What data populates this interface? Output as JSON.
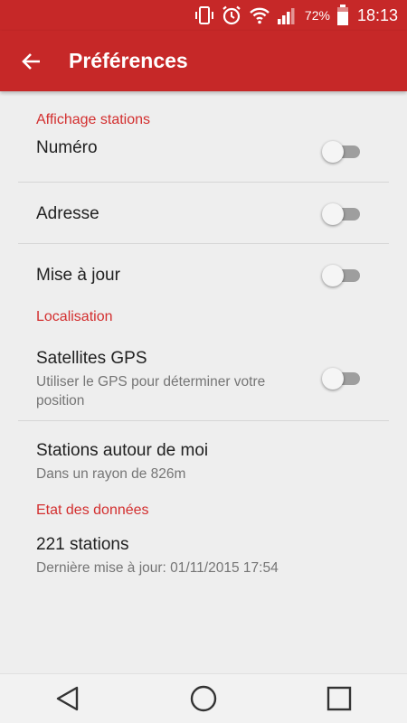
{
  "status_bar": {
    "battery_percent": "72%",
    "time": "18:13",
    "icons": [
      "vibrate-icon",
      "alarm-icon",
      "wifi-icon",
      "signal-icon",
      "battery-icon"
    ]
  },
  "app_bar": {
    "title": "Préférences",
    "back_icon": "arrow-back-icon"
  },
  "sections": {
    "display": {
      "header": "Affichage stations",
      "numero": {
        "label": "Numéro",
        "enabled": false
      },
      "adresse": {
        "label": "Adresse",
        "enabled": false
      },
      "mise_a_jour": {
        "label": "Mise à jour",
        "enabled": false
      }
    },
    "location": {
      "header": "Localisation",
      "gps": {
        "label": "Satellites GPS",
        "summary": "Utiliser le GPS pour déterminer votre position",
        "enabled": false
      },
      "nearby": {
        "label": "Stations autour de moi",
        "summary": "Dans un rayon de 826m"
      }
    },
    "data_state": {
      "header": "Etat des données",
      "stations": {
        "label": "221 stations",
        "summary": "Dernière mise à jour: 01/11/2015 17:54"
      }
    }
  },
  "colors": {
    "primary": "#c62828",
    "accent_text": "#d32f2f",
    "background": "#eeeeee"
  }
}
